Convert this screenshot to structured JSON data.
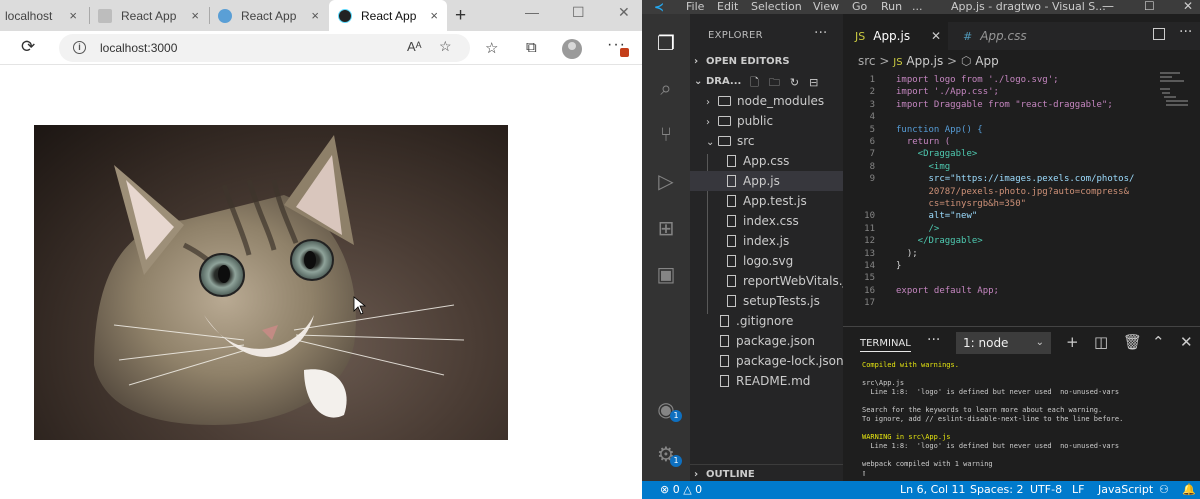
{
  "browser": {
    "tabs": [
      {
        "label": "localhost",
        "active": false
      },
      {
        "label": "React App",
        "active": false
      },
      {
        "label": "React App",
        "active": false
      },
      {
        "label": "React App",
        "active": true
      }
    ],
    "new_tab": "+",
    "close": "×",
    "window_controls": {
      "minimize": "—",
      "maximize": "☐",
      "close": "✕"
    },
    "url": "localhost:3000",
    "info": "i",
    "read_aloud": "Aᴬ",
    "icons": [
      "refresh-icon",
      "info-icon",
      "read-aloud-icon",
      "add-favorite-icon",
      "favorites-icon",
      "collections-icon",
      "profile-icon",
      "more-icon"
    ],
    "content_image": "cat-photo"
  },
  "vscode": {
    "title": "App.js - dragtwo - Visual S...",
    "menu": [
      "File",
      "Edit",
      "Selection",
      "View",
      "Go",
      "Run",
      "..."
    ],
    "window_controls": {
      "minimize": "—",
      "maximize": "☐",
      "close": "✕"
    },
    "explorer": {
      "title": "EXPLORER",
      "dots": "···",
      "open_editors": "OPEN EDITORS",
      "project": "DRA...",
      "outline": "OUTLINE",
      "tree": [
        {
          "label": "node_modules",
          "kind": "folder",
          "expanded": false
        },
        {
          "label": "public",
          "kind": "folder",
          "expanded": false
        },
        {
          "label": "src",
          "kind": "folder",
          "expanded": true
        },
        {
          "label": "App.css",
          "kind": "file"
        },
        {
          "label": "App.js",
          "kind": "file",
          "selected": true
        },
        {
          "label": "App.test.js",
          "kind": "file"
        },
        {
          "label": "index.css",
          "kind": "file"
        },
        {
          "label": "index.js",
          "kind": "file"
        },
        {
          "label": "logo.svg",
          "kind": "file"
        },
        {
          "label": "reportWebVitals.js",
          "kind": "file"
        },
        {
          "label": "setupTests.js",
          "kind": "file"
        },
        {
          "label": ".gitignore",
          "kind": "file"
        },
        {
          "label": "package.json",
          "kind": "file"
        },
        {
          "label": "package-lock.json",
          "kind": "file"
        },
        {
          "label": "README.md",
          "kind": "file"
        }
      ]
    },
    "editor_tabs": [
      {
        "label": "App.js",
        "active": true,
        "icon": "JS"
      },
      {
        "label": "App.css",
        "active": false,
        "icon": "#"
      }
    ],
    "breadcrumb": {
      "folder": "src",
      "sep": ">",
      "file": "App.js",
      "symbol": "App"
    },
    "code_lines": [
      {
        "n": "1",
        "text": "import logo from './logo.svg';"
      },
      {
        "n": "2",
        "text": "import './App.css';"
      },
      {
        "n": "3",
        "text": "import Draggable from \"react-draggable\";"
      },
      {
        "n": "4",
        "text": ""
      },
      {
        "n": "5",
        "text": "function App() {"
      },
      {
        "n": "6",
        "text": "  return ("
      },
      {
        "n": "7",
        "text": "    <Draggable>"
      },
      {
        "n": "8",
        "text": "      <img"
      },
      {
        "n": "9",
        "text": "      src=\"https://images.pexels.com/photos/"
      },
      {
        "n": "",
        "text": "      20787/pexels-photo.jpg?auto=compress&"
      },
      {
        "n": "",
        "text": "      cs=tinysrgb&h=350\""
      },
      {
        "n": "10",
        "text": "      alt=\"new\""
      },
      {
        "n": "11",
        "text": "      />"
      },
      {
        "n": "12",
        "text": "    </Draggable>"
      },
      {
        "n": "13",
        "text": "  );"
      },
      {
        "n": "14",
        "text": "}"
      },
      {
        "n": "15",
        "text": ""
      },
      {
        "n": "16",
        "text": "export default App;"
      },
      {
        "n": "17",
        "text": ""
      }
    ],
    "panel": {
      "title": "TERMINAL",
      "dots": "···",
      "terminal_select": "1: node",
      "lines": [
        "Compiled with warnings.",
        "",
        "src\\App.js",
        "  Line 1:8:  'logo' is defined but never used  no-unused-vars",
        "",
        "Search for the keywords to learn more about each warning.",
        "To ignore, add // eslint-disable-next-line to the line before.",
        "",
        "WARNING in src\\App.js",
        "  Line 1:8:  'logo' is defined but never used  no-unused-vars",
        "",
        "webpack compiled with 1 warning",
        "▯"
      ]
    },
    "status": {
      "problems": "⊗ 0 △ 0",
      "position": "Ln 6, Col 11",
      "spaces": "Spaces: 2",
      "encoding": "UTF-8",
      "eol": "LF",
      "language": "JavaScript"
    },
    "activity_badges": {
      "accounts": "1",
      "settings": "1"
    }
  },
  "colors": {
    "vscode_blue": "#007acc",
    "browser_tab_bg": "#dcdcdc"
  }
}
